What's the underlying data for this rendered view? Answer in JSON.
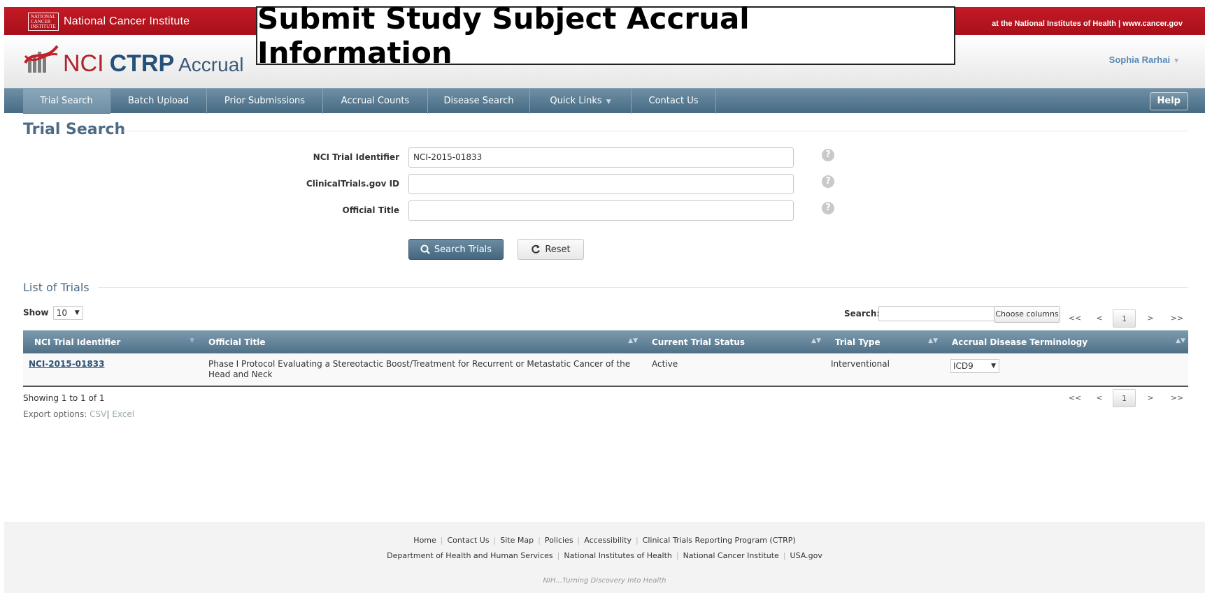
{
  "banner": {
    "logo_text": "National Cancer Institute",
    "title": "National Cancer Institute",
    "right_link": "at the National Institutes of Health | www.cancer.gov"
  },
  "header": {
    "logo_nci": "NCI",
    "logo_ctrp": "CTRP",
    "logo_app": "Accrual",
    "user_name": "Sophia Rarhai"
  },
  "overlay_title": "Submit Study Subject Accrual Information",
  "nav": {
    "items": [
      {
        "label": "Trial Search"
      },
      {
        "label": "Batch Upload"
      },
      {
        "label": "Prior Submissions"
      },
      {
        "label": "Accrual Counts"
      },
      {
        "label": "Disease Search"
      },
      {
        "label": "Quick Links"
      },
      {
        "label": "Contact Us"
      }
    ],
    "help_label": "Help"
  },
  "trial_search": {
    "section_title": "Trial Search",
    "fields": [
      {
        "label": "NCI Trial Identifier",
        "value": "NCI-2015-01833"
      },
      {
        "label": "ClinicalTrials.gov ID",
        "value": ""
      },
      {
        "label": "Official Title",
        "value": ""
      }
    ],
    "search_button": "Search Trials",
    "reset_button": "Reset"
  },
  "list": {
    "section_title": "List of Trials",
    "show_label": "Show",
    "show_value": "10",
    "search_label": "Search:",
    "choose_columns": "Choose columns",
    "pager": {
      "first": "<<",
      "prev": "<",
      "current": "1",
      "next": ">",
      "last": ">>"
    },
    "columns": [
      "NCI Trial Identifier",
      "Official Title",
      "Current Trial Status",
      "Trial Type",
      "Accrual Disease Terminology"
    ],
    "rows": [
      {
        "id": "NCI-2015-01833",
        "title": "Phase I Protocol Evaluating a Stereotactic Boost/Treatment for Recurrent or Metastatic Cancer of the Head and Neck",
        "status": "Active",
        "type": "Interventional",
        "terminology": "ICD9"
      }
    ],
    "showing": "Showing 1 to 1 of 1",
    "export_label": "Export options:",
    "export_csv": "CSV",
    "export_excel": "Excel"
  },
  "footer": {
    "row1": [
      "Home",
      "Contact Us",
      "Site Map",
      "Policies",
      "Accessibility",
      "Clinical Trials Reporting Program (CTRP)"
    ],
    "row2": [
      "Department of Health and Human Services",
      "National Institutes of Health",
      "National Cancer Institute",
      "USA.gov"
    ],
    "tagline": "NIH...Turning Discovery Into Health"
  },
  "colors": {
    "banner_red": "#b5121b",
    "nav_blue": "#4e7188",
    "heading_blue": "#4d6b86",
    "link_blue": "#2c5277"
  }
}
